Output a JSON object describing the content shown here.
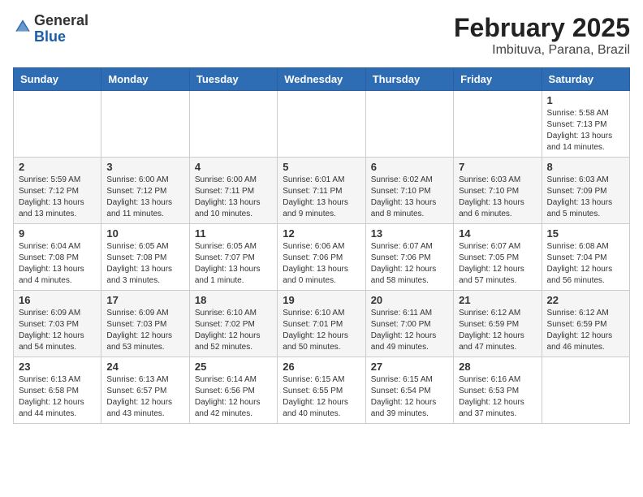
{
  "header": {
    "logo_general": "General",
    "logo_blue": "Blue",
    "month_year": "February 2025",
    "location": "Imbituva, Parana, Brazil"
  },
  "days_of_week": [
    "Sunday",
    "Monday",
    "Tuesday",
    "Wednesday",
    "Thursday",
    "Friday",
    "Saturday"
  ],
  "weeks": [
    [
      {
        "day": "",
        "info": ""
      },
      {
        "day": "",
        "info": ""
      },
      {
        "day": "",
        "info": ""
      },
      {
        "day": "",
        "info": ""
      },
      {
        "day": "",
        "info": ""
      },
      {
        "day": "",
        "info": ""
      },
      {
        "day": "1",
        "info": "Sunrise: 5:58 AM\nSunset: 7:13 PM\nDaylight: 13 hours and 14 minutes."
      }
    ],
    [
      {
        "day": "2",
        "info": "Sunrise: 5:59 AM\nSunset: 7:12 PM\nDaylight: 13 hours and 13 minutes."
      },
      {
        "day": "3",
        "info": "Sunrise: 6:00 AM\nSunset: 7:12 PM\nDaylight: 13 hours and 11 minutes."
      },
      {
        "day": "4",
        "info": "Sunrise: 6:00 AM\nSunset: 7:11 PM\nDaylight: 13 hours and 10 minutes."
      },
      {
        "day": "5",
        "info": "Sunrise: 6:01 AM\nSunset: 7:11 PM\nDaylight: 13 hours and 9 minutes."
      },
      {
        "day": "6",
        "info": "Sunrise: 6:02 AM\nSunset: 7:10 PM\nDaylight: 13 hours and 8 minutes."
      },
      {
        "day": "7",
        "info": "Sunrise: 6:03 AM\nSunset: 7:10 PM\nDaylight: 13 hours and 6 minutes."
      },
      {
        "day": "8",
        "info": "Sunrise: 6:03 AM\nSunset: 7:09 PM\nDaylight: 13 hours and 5 minutes."
      }
    ],
    [
      {
        "day": "9",
        "info": "Sunrise: 6:04 AM\nSunset: 7:08 PM\nDaylight: 13 hours and 4 minutes."
      },
      {
        "day": "10",
        "info": "Sunrise: 6:05 AM\nSunset: 7:08 PM\nDaylight: 13 hours and 3 minutes."
      },
      {
        "day": "11",
        "info": "Sunrise: 6:05 AM\nSunset: 7:07 PM\nDaylight: 13 hours and 1 minute."
      },
      {
        "day": "12",
        "info": "Sunrise: 6:06 AM\nSunset: 7:06 PM\nDaylight: 13 hours and 0 minutes."
      },
      {
        "day": "13",
        "info": "Sunrise: 6:07 AM\nSunset: 7:06 PM\nDaylight: 12 hours and 58 minutes."
      },
      {
        "day": "14",
        "info": "Sunrise: 6:07 AM\nSunset: 7:05 PM\nDaylight: 12 hours and 57 minutes."
      },
      {
        "day": "15",
        "info": "Sunrise: 6:08 AM\nSunset: 7:04 PM\nDaylight: 12 hours and 56 minutes."
      }
    ],
    [
      {
        "day": "16",
        "info": "Sunrise: 6:09 AM\nSunset: 7:03 PM\nDaylight: 12 hours and 54 minutes."
      },
      {
        "day": "17",
        "info": "Sunrise: 6:09 AM\nSunset: 7:03 PM\nDaylight: 12 hours and 53 minutes."
      },
      {
        "day": "18",
        "info": "Sunrise: 6:10 AM\nSunset: 7:02 PM\nDaylight: 12 hours and 52 minutes."
      },
      {
        "day": "19",
        "info": "Sunrise: 6:10 AM\nSunset: 7:01 PM\nDaylight: 12 hours and 50 minutes."
      },
      {
        "day": "20",
        "info": "Sunrise: 6:11 AM\nSunset: 7:00 PM\nDaylight: 12 hours and 49 minutes."
      },
      {
        "day": "21",
        "info": "Sunrise: 6:12 AM\nSunset: 6:59 PM\nDaylight: 12 hours and 47 minutes."
      },
      {
        "day": "22",
        "info": "Sunrise: 6:12 AM\nSunset: 6:59 PM\nDaylight: 12 hours and 46 minutes."
      }
    ],
    [
      {
        "day": "23",
        "info": "Sunrise: 6:13 AM\nSunset: 6:58 PM\nDaylight: 12 hours and 44 minutes."
      },
      {
        "day": "24",
        "info": "Sunrise: 6:13 AM\nSunset: 6:57 PM\nDaylight: 12 hours and 43 minutes."
      },
      {
        "day": "25",
        "info": "Sunrise: 6:14 AM\nSunset: 6:56 PM\nDaylight: 12 hours and 42 minutes."
      },
      {
        "day": "26",
        "info": "Sunrise: 6:15 AM\nSunset: 6:55 PM\nDaylight: 12 hours and 40 minutes."
      },
      {
        "day": "27",
        "info": "Sunrise: 6:15 AM\nSunset: 6:54 PM\nDaylight: 12 hours and 39 minutes."
      },
      {
        "day": "28",
        "info": "Sunrise: 6:16 AM\nSunset: 6:53 PM\nDaylight: 12 hours and 37 minutes."
      },
      {
        "day": "",
        "info": ""
      }
    ]
  ]
}
